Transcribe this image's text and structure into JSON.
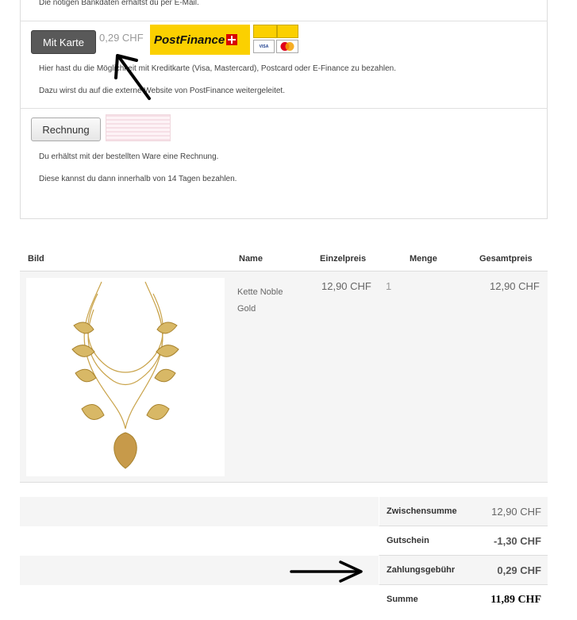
{
  "payment": {
    "bank_note": "Die nötigen Bankdaten erhältst du per E-Mail.",
    "card_option": {
      "button_label": "Mit Karte",
      "fee": "0,29 CHF",
      "logo_text": "PostFinance",
      "line1": "Hier hast du die Möglichkeit mit Kreditkarte (Visa, Mastercard), Postcard oder E-Finance zu bezahlen.",
      "line2": "Dazu wirst du auf die externe Website von PostFinance weitergeleitet."
    },
    "invoice_option": {
      "button_label": "Rechnung",
      "line1": "Du erhältst mit der bestellten Ware eine Rechnung.",
      "line2": "Diese kannst du dann innerhalb von 14 Tagen bezahlen."
    }
  },
  "table": {
    "headers": {
      "image": "Bild",
      "name": "Name",
      "unit_price": "Einzelpreis",
      "quantity": "Menge",
      "total": "Gesamtpreis"
    },
    "rows": [
      {
        "name_line1": "Kette Noble",
        "name_line2": "Gold",
        "unit_price": "12,90 CHF",
        "quantity": "1",
        "total": "12,90 CHF"
      }
    ]
  },
  "totals": {
    "subtotal_label": "Zwischensumme",
    "subtotal_value": "12,90 CHF",
    "voucher_label": "Gutschein",
    "voucher_value": "-1,30 CHF",
    "fee_label": "Zahlungsgebühr",
    "fee_value": "0,29 CHF",
    "sum_label": "Summe",
    "sum_value": "11,89 CHF"
  },
  "colors": {
    "postfinance_yellow": "#fbd000",
    "swiss_red": "#d80000",
    "button_dark": "#595959"
  }
}
